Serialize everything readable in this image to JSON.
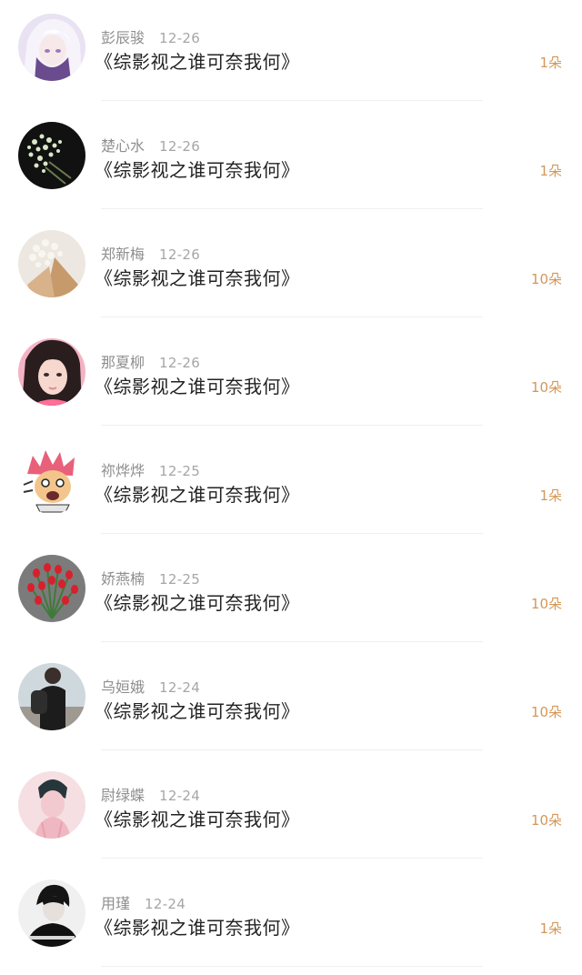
{
  "gift_list": [
    {
      "name": "彭辰骏",
      "date": "12-26",
      "title": "《综影视之谁可奈我何》",
      "count": "1朵"
    },
    {
      "name": "楚心水",
      "date": "12-26",
      "title": "《综影视之谁可奈我何》",
      "count": "1朵"
    },
    {
      "name": "郑新梅",
      "date": "12-26",
      "title": "《综影视之谁可奈我何》",
      "count": "10朵"
    },
    {
      "name": "那夏柳",
      "date": "12-26",
      "title": "《综影视之谁可奈我何》",
      "count": "10朵"
    },
    {
      "name": "祢烨烨",
      "date": "12-25",
      "title": "《综影视之谁可奈我何》",
      "count": "1朵"
    },
    {
      "name": "娇燕楠",
      "date": "12-25",
      "title": "《综影视之谁可奈我何》",
      "count": "10朵"
    },
    {
      "name": "乌姮娥",
      "date": "12-24",
      "title": "《综影视之谁可奈我何》",
      "count": "10朵"
    },
    {
      "name": "尉绿蝶",
      "date": "12-24",
      "title": "《综影视之谁可奈我何》",
      "count": "10朵"
    },
    {
      "name": "用瑾",
      "date": "12-24",
      "title": "《综影视之谁可奈我何》",
      "count": "1朵"
    }
  ],
  "colors": {
    "count_text": "#d49759",
    "name_text": "#8f8f8f",
    "title_text": "#222222"
  }
}
